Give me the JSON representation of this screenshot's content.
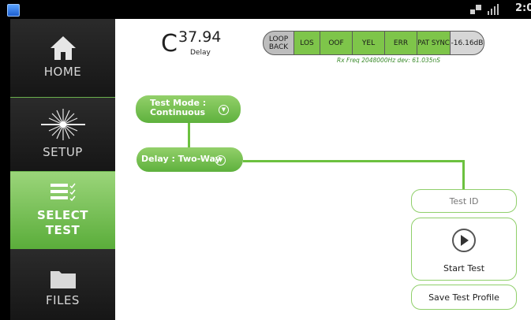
{
  "statusbar": {
    "time": "2:0"
  },
  "sidebar": {
    "items": [
      {
        "label": "HOME"
      },
      {
        "label": "SETUP"
      },
      {
        "label_line1": "SELECT",
        "label_line2": "TEST"
      },
      {
        "label": "FILES"
      }
    ]
  },
  "delay": {
    "unit": "C",
    "value": "37.94",
    "label": "Delay"
  },
  "indicators": {
    "loop_line1": "LOOP",
    "loop_line2": "BACK",
    "los": "LOS",
    "oof": "OOF",
    "yel": "YEL",
    "err": "ERR",
    "pat_sync": "PAT SYNC",
    "level": "-16.16dB",
    "rx_freq": "Rx Freq 2048000Hz dev: 61.035nS"
  },
  "test_mode": {
    "line1": "Test Mode :",
    "line2": "Continuous"
  },
  "delay_mode": {
    "label": "Delay : Two-Way"
  },
  "buttons": {
    "test_id": "Test ID",
    "start_test": "Start Test",
    "save_profile": "Save Test Profile"
  }
}
